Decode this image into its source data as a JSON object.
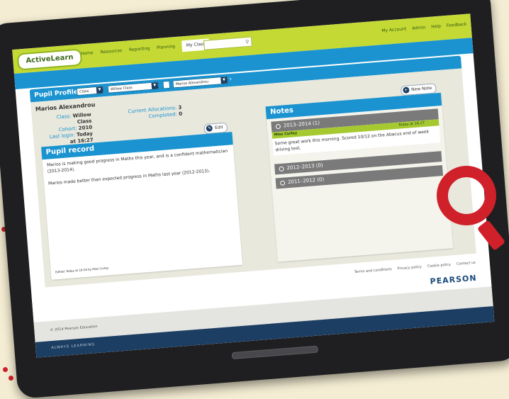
{
  "app": {
    "logo": "ActiveLearn",
    "accent": "#1a93d0",
    "brand_green": "#c5d934"
  },
  "nav": {
    "items": [
      "Home",
      "Resources",
      "Reporting",
      "Planning",
      "My Class"
    ],
    "active": "My Class"
  },
  "topnav_right": [
    "My Account",
    "Admin",
    "Help",
    "Feedback"
  ],
  "search": {
    "placeholder": ""
  },
  "profile_bar": {
    "title": "Pupil Profile",
    "filter1": "Class",
    "filter2": "Willow Class",
    "filter3": "Marios Alexandrou"
  },
  "pupil": {
    "name": "Marios Alexandrou",
    "class_label": "Class:",
    "class_value": "Willow Class",
    "cohort_label": "Cohort:",
    "cohort_value": "2010",
    "login_label": "Last login:",
    "login_value": "Today at 16:27",
    "alloc_label": "Current Allocations:",
    "alloc_value": "3",
    "completed_label": "Completed:",
    "completed_value": "0"
  },
  "pupil_record": {
    "title": "Pupil record",
    "edit_label": "Edit",
    "text1": "Marios is making good progress in Maths this year, and is a confident mathematician (2013-2014).",
    "text2": "Marios made better than expected progress in Maths last year (2012-2013).",
    "edited": "Edited: Today at 16:28 by Miss Curley"
  },
  "notes": {
    "title": "Notes",
    "new_note_label": "New Note",
    "years": [
      {
        "label": "2013–2014 (1)"
      },
      {
        "label": "2012–2013 (0)"
      },
      {
        "label": "2011–2012 (0)"
      }
    ],
    "note": {
      "author": "Miss Curley",
      "time": "Today at 16:27",
      "text": "Some great work this morning. Scored 10/12 on the Abacus end of week driving test."
    }
  },
  "footer": {
    "links": [
      "Terms and conditions",
      "Privacy policy",
      "Cookie policy",
      "Contact us"
    ],
    "brand": "PEARSON",
    "copyright": "© 2014 Pearson Education",
    "tagline": "ALWAYS LEARNING"
  }
}
